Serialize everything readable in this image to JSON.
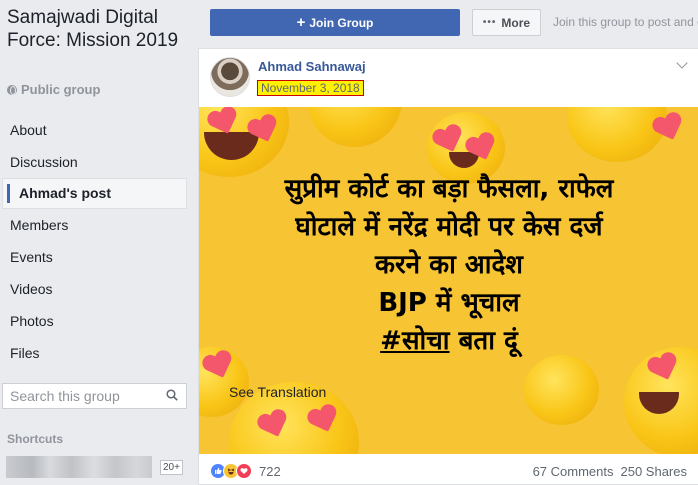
{
  "group": {
    "title": "Samajwadi Digital Force: Mission 2019",
    "type": "Public group"
  },
  "nav": [
    {
      "label": "About"
    },
    {
      "label": "Discussion"
    },
    {
      "label": "Ahmad's post",
      "active": true
    },
    {
      "label": "Members"
    },
    {
      "label": "Events"
    },
    {
      "label": "Videos"
    },
    {
      "label": "Photos"
    },
    {
      "label": "Files"
    }
  ],
  "search": {
    "placeholder": "Search this group"
  },
  "shortcuts": {
    "title": "Shortcuts",
    "badge": "20+"
  },
  "topbar": {
    "join_label": "Join Group",
    "more_label": "More",
    "hint": "Join this group to post and c"
  },
  "post": {
    "author": "Ahmad Sahnawaj",
    "date": "November 3, 2018",
    "headline": [
      "सुप्रीम कोर्ट का बड़ा फैसला, राफेल",
      "घोटाले में नरेंद्र मोदी पर केस दर्ज",
      "करने का आदेश",
      "BJP में भूचाल"
    ],
    "headline_tag": "#सोचा",
    "headline_tail": " बता दूं",
    "see_translation": "See Translation",
    "reaction_count": "722",
    "comments": "67 Comments",
    "shares": "250 Shares"
  },
  "colors": {
    "brand": "#4267b2",
    "image_bg": "#f7c433",
    "date_highlight": "#fff200"
  }
}
